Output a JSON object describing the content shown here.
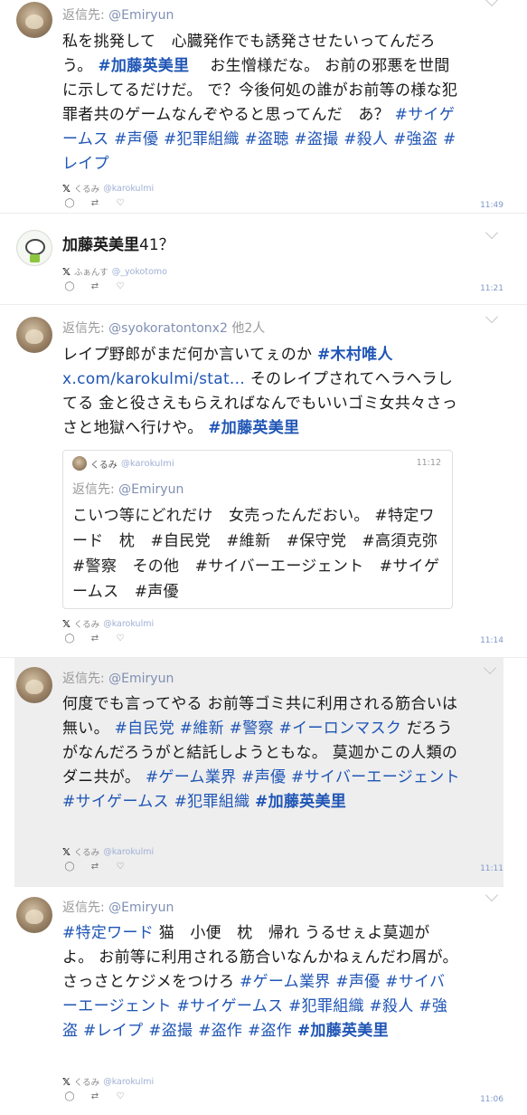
{
  "reply_prefix": "返信先:",
  "tweets": [
    {
      "reply_to": "@Emiryun",
      "body_pre": "私を挑発して　心臓発作でも誘発させたいってんだろう。",
      "tag1": "#加藤英美里",
      "body_mid": "　お生憎様だな。 お前の邪悪を世間に示してるだけだ。 で？今後何処の誰がお前等の様な犯罪者共のゲームなんぞやると思ってんだ　あ？",
      "tags_tail": [
        "#サイゲームス",
        "#声優",
        "#犯罪組織",
        "#盗聴",
        "#盗撮",
        "#殺人",
        "#強盗",
        "#レイプ"
      ],
      "source_name": "くるみ",
      "source_handle": "@karokulmi",
      "time": "11:49"
    },
    {
      "title_bold": "加藤英美里",
      "title_rest": "41？",
      "source_name": "ふぁんす",
      "source_handle": "@_yokotomo",
      "time": "11:21"
    },
    {
      "reply_to": "@syokoratontonx2",
      "reply_others": "他2人",
      "body_pre": "レイプ野郎がまだ何か言いてぇのか",
      "tag1": "#木村唯人",
      "link": "x.com/karokulmi/stat...",
      "body_mid": "そのレイプされてヘラヘラしてる 金と役さえもらえればなんでもいいゴミ女共々さっさと地獄へ行けや。",
      "tag_end": "#加藤英美里",
      "quote": {
        "name": "くるみ",
        "handle": "@karokulmi",
        "time": "11:12",
        "reply_to": "@Emiryun",
        "body": "こいつ等にどれだけ　女売ったんだおい。 #特定ワード　枕　#自民党　#維新　#保守党　#高須克弥　#警察　その他　#サイバーエージェント　#サイゲームス　#声優"
      },
      "source_name": "くるみ",
      "source_handle": "@karokulmi",
      "time": "11:14"
    },
    {
      "reply_to": "@Emiryun",
      "body_pre": "何度でも言ってやる お前等ゴミ共に利用される筋合いは無い。",
      "tags_a": [
        "#自民党",
        "#維新",
        "#警察",
        "#イーロンマスク"
      ],
      "body_mid": "だろうがなんだろうがと結託しようともな。 莫迦かこの人類のダニ共が。",
      "tags_b": [
        "#ゲーム業界",
        "#声優",
        "#サイバーエージェント",
        "#サイゲームス",
        "#犯罪組織"
      ],
      "tag_end": "#加藤英美里",
      "source_name": "くるみ",
      "source_handle": "@karokulmi",
      "time": "11:11"
    },
    {
      "reply_to": "@Emiryun",
      "tag_start": "#特定ワード",
      "body_pre": "猫　小便　枕　帰れ うるせぇよ莫迦がよ。 お前等に利用される筋合いなんかねぇんだわ屑が。 さっさとケジメをつけろ",
      "tags_a": [
        "#ゲーム業界",
        "#声優",
        "#サイバーエージェント",
        "#サイゲームス",
        "#犯罪組織",
        "#殺人",
        "#強盗",
        "#レイプ",
        "#盗撮",
        "#盗作",
        "#盗作"
      ],
      "tag_end": "#加藤英美里",
      "source_name": "くるみ",
      "source_handle": "@karokulmi",
      "time": "11:06"
    }
  ],
  "icons": {
    "x": "x-logo-icon",
    "reply": "reply-icon",
    "retweet": "retweet-icon",
    "like": "heart-icon",
    "menu": "chevron-down-icon"
  },
  "colors": {
    "hashtag": "#1f55b5",
    "time": "#7f98c9",
    "highlight_bg": "#eeeeee"
  }
}
